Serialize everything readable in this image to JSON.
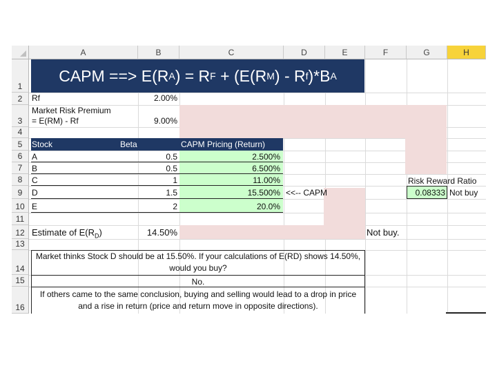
{
  "columns": [
    "A",
    "B",
    "C",
    "D",
    "E",
    "F",
    "G",
    "H"
  ],
  "selected_column": "H",
  "rows": [
    "1",
    "2",
    "3",
    "4",
    "5",
    "6",
    "7",
    "8",
    "9",
    "10",
    "11",
    "12",
    "13",
    "14",
    "15",
    "16"
  ],
  "title": {
    "text": "CAPM ==> E(R",
    "sub1": "A",
    "mid1": ") = R",
    "sub2": "F",
    "mid2": " + (E(R",
    "sub3": "M",
    "mid3": ") - R",
    "sub4": "f",
    "mid4": ")*B",
    "sub5": "A"
  },
  "rf": {
    "label": "Rf",
    "value": "2.00%"
  },
  "mrp": {
    "label1": "Market Risk Premium",
    "label2": "= E(RM) - Rf",
    "value": "9.00%"
  },
  "table": {
    "headers": [
      "Stock",
      "Beta",
      "CAPM Pricing (Return)"
    ],
    "rows": [
      {
        "stock": "A",
        "beta": "0.5",
        "capm": "2.500%"
      },
      {
        "stock": "B",
        "beta": "0.5",
        "capm": "6.500%"
      },
      {
        "stock": "C",
        "beta": "1",
        "capm": "11.00%"
      },
      {
        "stock": "D",
        "beta": "1.5",
        "capm": "15.500%"
      },
      {
        "stock": "E",
        "beta": "2",
        "capm": "20.0%"
      }
    ]
  },
  "capm_arrow": "<<-- CAPM",
  "risk_reward": {
    "label": "Risk Reward Ratio",
    "value": "0.08333",
    "decision": "Not buy"
  },
  "estimate": {
    "label_main": "Estimate of E(R",
    "label_sub": "D",
    "label_end": ")",
    "value": "14.50%"
  },
  "not_buy": "Not buy.",
  "question": {
    "line1": "Market thinks Stock D should be at 15.50%. If your calculations of E(RD) shows 14.50%,",
    "line2": "would you buy?"
  },
  "answer": "No.",
  "explanation": {
    "line1": "If others came to the same conclusion, buying and selling would lead to a drop in price",
    "line2": "and a rise in return (price and return move in opposite directions)."
  },
  "colors": {
    "header_navy": "#1f3864",
    "green_cell": "#ccffcc",
    "pink_shape": "#f2dcdb",
    "selected_header": "#f7d33a"
  }
}
